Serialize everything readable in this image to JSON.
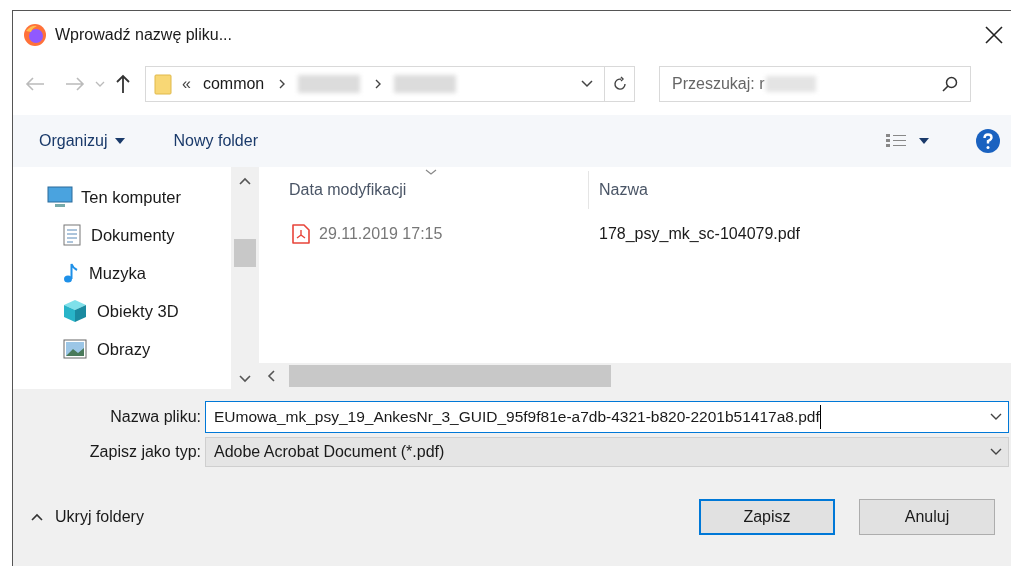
{
  "window": {
    "title": "Wprowadź nazwę pliku..."
  },
  "address_bar": {
    "overflow": "«",
    "segments": [
      {
        "kind": "text",
        "label": "common"
      },
      {
        "kind": "hidden"
      },
      {
        "kind": "hidden"
      }
    ]
  },
  "search": {
    "placeholder": "Przeszukaj: r"
  },
  "toolbar": {
    "organize": "Organizuj",
    "new_folder": "Nowy folder"
  },
  "sidebar": {
    "items": [
      {
        "label": "Ten komputer",
        "kind": "computer",
        "children": [
          {
            "label": "Dokumenty",
            "kind": "documents"
          },
          {
            "label": "Muzyka",
            "kind": "music"
          },
          {
            "label": "Obiekty 3D",
            "kind": "objects"
          },
          {
            "label": "Obrazy",
            "kind": "pictures"
          }
        ]
      }
    ]
  },
  "table": {
    "columns": [
      "Data modyfikacji",
      "Nazwa"
    ],
    "rows": [
      {
        "date": "29.11.2019 17:15",
        "name": "178_psy_mk_sc-104079.pdf"
      }
    ]
  },
  "file_name": {
    "label": "Nazwa pliku:",
    "value": "EUmowa_mk_psy_19_AnkesNr_3_GUID_95f9f81e-a7db-4321-b820-2201b51417a8.pdf"
  },
  "file_type": {
    "label": "Zapisz jako typ:",
    "value": "Adobe Acrobat Document (*.pdf)"
  },
  "hide_folders": "Ukryj foldery",
  "buttons": [
    {
      "label": "Zapisz",
      "default": true
    },
    {
      "label": "Anuluj",
      "default": false
    }
  ]
}
